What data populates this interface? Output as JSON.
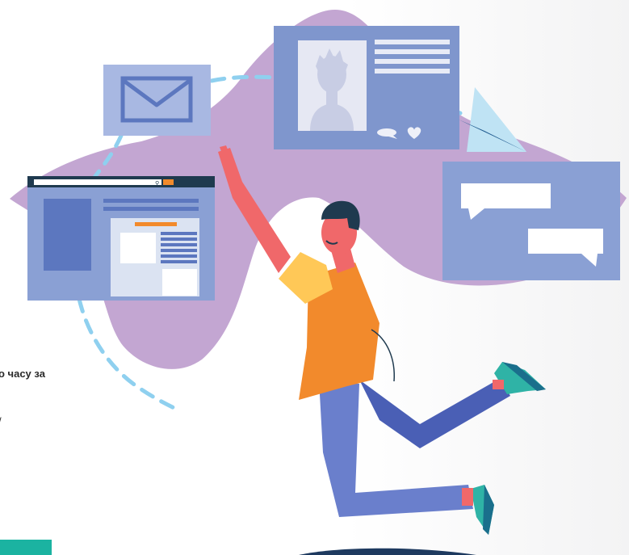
{
  "fragments": {
    "line1": "о часу за",
    "line2": "/"
  },
  "search_box": {
    "dots": "..."
  },
  "colors": {
    "blob": "#c3a6d2",
    "panel": "#8aa0d4",
    "panel_dark": "#5c77bf",
    "dash": "#8fd0ef",
    "accent_orange": "#f28a2c",
    "teal": "#1bb3a1",
    "navy": "#1e3a5f"
  },
  "icons": [
    "envelope-icon",
    "search-icon",
    "heart-icon",
    "chat-icon",
    "paper-plane-icon",
    "profile-avatar-icon"
  ]
}
